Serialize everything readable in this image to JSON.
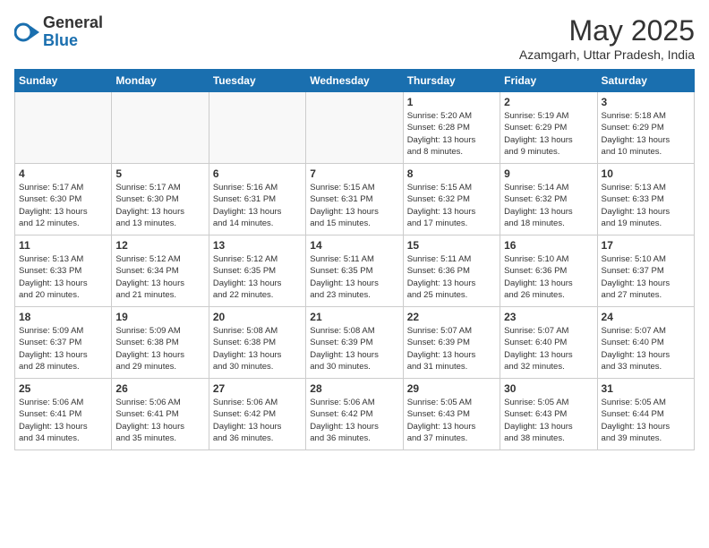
{
  "header": {
    "logo_general": "General",
    "logo_blue": "Blue",
    "month_title": "May 2025",
    "location": "Azamgarh, Uttar Pradesh, India"
  },
  "calendar": {
    "days_of_week": [
      "Sunday",
      "Monday",
      "Tuesday",
      "Wednesday",
      "Thursday",
      "Friday",
      "Saturday"
    ],
    "weeks": [
      [
        {
          "day": "",
          "info": ""
        },
        {
          "day": "",
          "info": ""
        },
        {
          "day": "",
          "info": ""
        },
        {
          "day": "",
          "info": ""
        },
        {
          "day": "1",
          "info": "Sunrise: 5:20 AM\nSunset: 6:28 PM\nDaylight: 13 hours\nand 8 minutes."
        },
        {
          "day": "2",
          "info": "Sunrise: 5:19 AM\nSunset: 6:29 PM\nDaylight: 13 hours\nand 9 minutes."
        },
        {
          "day": "3",
          "info": "Sunrise: 5:18 AM\nSunset: 6:29 PM\nDaylight: 13 hours\nand 10 minutes."
        }
      ],
      [
        {
          "day": "4",
          "info": "Sunrise: 5:17 AM\nSunset: 6:30 PM\nDaylight: 13 hours\nand 12 minutes."
        },
        {
          "day": "5",
          "info": "Sunrise: 5:17 AM\nSunset: 6:30 PM\nDaylight: 13 hours\nand 13 minutes."
        },
        {
          "day": "6",
          "info": "Sunrise: 5:16 AM\nSunset: 6:31 PM\nDaylight: 13 hours\nand 14 minutes."
        },
        {
          "day": "7",
          "info": "Sunrise: 5:15 AM\nSunset: 6:31 PM\nDaylight: 13 hours\nand 15 minutes."
        },
        {
          "day": "8",
          "info": "Sunrise: 5:15 AM\nSunset: 6:32 PM\nDaylight: 13 hours\nand 17 minutes."
        },
        {
          "day": "9",
          "info": "Sunrise: 5:14 AM\nSunset: 6:32 PM\nDaylight: 13 hours\nand 18 minutes."
        },
        {
          "day": "10",
          "info": "Sunrise: 5:13 AM\nSunset: 6:33 PM\nDaylight: 13 hours\nand 19 minutes."
        }
      ],
      [
        {
          "day": "11",
          "info": "Sunrise: 5:13 AM\nSunset: 6:33 PM\nDaylight: 13 hours\nand 20 minutes."
        },
        {
          "day": "12",
          "info": "Sunrise: 5:12 AM\nSunset: 6:34 PM\nDaylight: 13 hours\nand 21 minutes."
        },
        {
          "day": "13",
          "info": "Sunrise: 5:12 AM\nSunset: 6:35 PM\nDaylight: 13 hours\nand 22 minutes."
        },
        {
          "day": "14",
          "info": "Sunrise: 5:11 AM\nSunset: 6:35 PM\nDaylight: 13 hours\nand 23 minutes."
        },
        {
          "day": "15",
          "info": "Sunrise: 5:11 AM\nSunset: 6:36 PM\nDaylight: 13 hours\nand 25 minutes."
        },
        {
          "day": "16",
          "info": "Sunrise: 5:10 AM\nSunset: 6:36 PM\nDaylight: 13 hours\nand 26 minutes."
        },
        {
          "day": "17",
          "info": "Sunrise: 5:10 AM\nSunset: 6:37 PM\nDaylight: 13 hours\nand 27 minutes."
        }
      ],
      [
        {
          "day": "18",
          "info": "Sunrise: 5:09 AM\nSunset: 6:37 PM\nDaylight: 13 hours\nand 28 minutes."
        },
        {
          "day": "19",
          "info": "Sunrise: 5:09 AM\nSunset: 6:38 PM\nDaylight: 13 hours\nand 29 minutes."
        },
        {
          "day": "20",
          "info": "Sunrise: 5:08 AM\nSunset: 6:38 PM\nDaylight: 13 hours\nand 30 minutes."
        },
        {
          "day": "21",
          "info": "Sunrise: 5:08 AM\nSunset: 6:39 PM\nDaylight: 13 hours\nand 30 minutes."
        },
        {
          "day": "22",
          "info": "Sunrise: 5:07 AM\nSunset: 6:39 PM\nDaylight: 13 hours\nand 31 minutes."
        },
        {
          "day": "23",
          "info": "Sunrise: 5:07 AM\nSunset: 6:40 PM\nDaylight: 13 hours\nand 32 minutes."
        },
        {
          "day": "24",
          "info": "Sunrise: 5:07 AM\nSunset: 6:40 PM\nDaylight: 13 hours\nand 33 minutes."
        }
      ],
      [
        {
          "day": "25",
          "info": "Sunrise: 5:06 AM\nSunset: 6:41 PM\nDaylight: 13 hours\nand 34 minutes."
        },
        {
          "day": "26",
          "info": "Sunrise: 5:06 AM\nSunset: 6:41 PM\nDaylight: 13 hours\nand 35 minutes."
        },
        {
          "day": "27",
          "info": "Sunrise: 5:06 AM\nSunset: 6:42 PM\nDaylight: 13 hours\nand 36 minutes."
        },
        {
          "day": "28",
          "info": "Sunrise: 5:06 AM\nSunset: 6:42 PM\nDaylight: 13 hours\nand 36 minutes."
        },
        {
          "day": "29",
          "info": "Sunrise: 5:05 AM\nSunset: 6:43 PM\nDaylight: 13 hours\nand 37 minutes."
        },
        {
          "day": "30",
          "info": "Sunrise: 5:05 AM\nSunset: 6:43 PM\nDaylight: 13 hours\nand 38 minutes."
        },
        {
          "day": "31",
          "info": "Sunrise: 5:05 AM\nSunset: 6:44 PM\nDaylight: 13 hours\nand 39 minutes."
        }
      ]
    ]
  }
}
